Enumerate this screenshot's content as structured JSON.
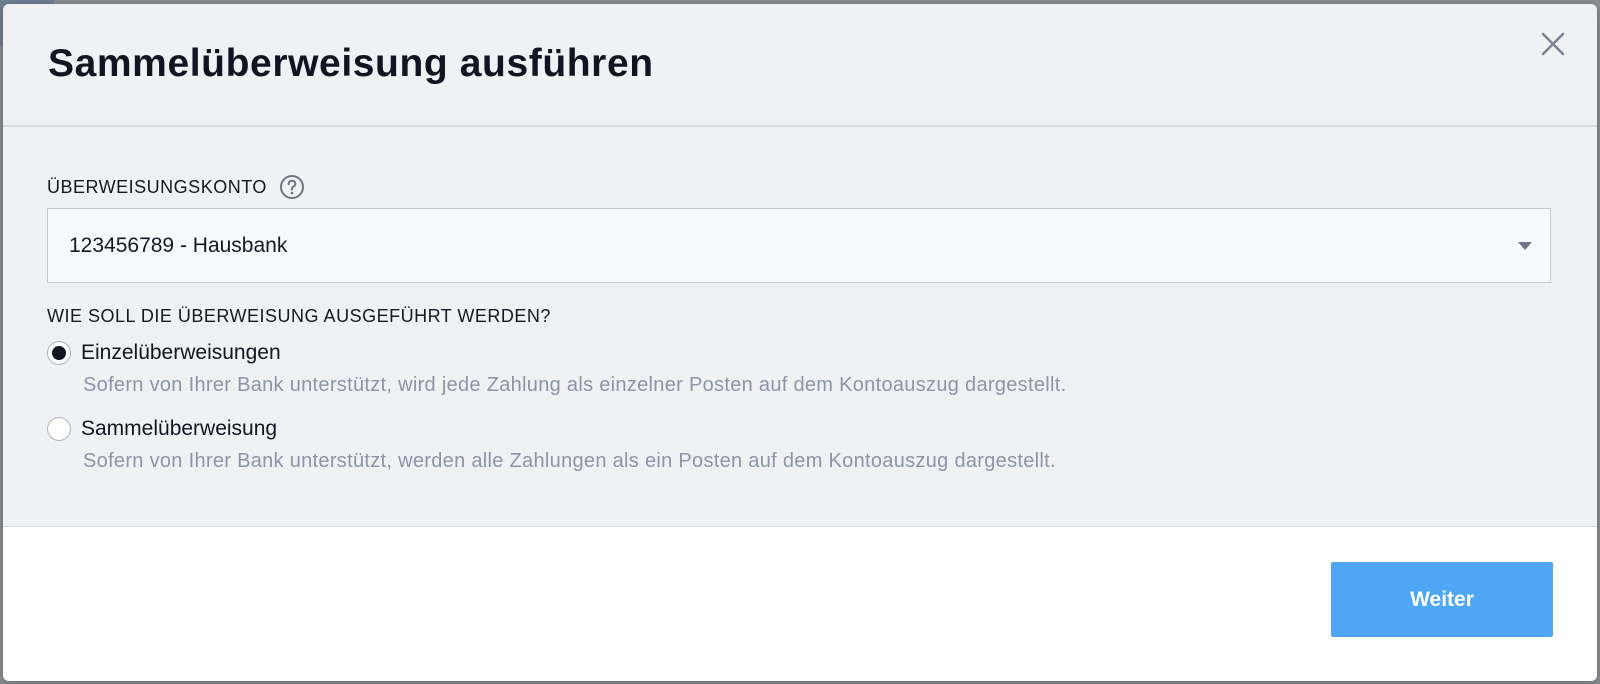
{
  "dialog": {
    "title": "Sammelüberweisung ausführen"
  },
  "account_field": {
    "label": "ÜBERWEISUNGSKONTO",
    "selected_value": "123456789 - Hausbank"
  },
  "execution": {
    "question": "WIE SOLL DIE ÜBERWEISUNG AUSGEFÜHRT WERDEN?",
    "options": [
      {
        "label": "Einzelüberweisungen",
        "description": "Sofern von Ihrer Bank unterstützt, wird jede Zahlung als einzelner Posten auf dem Kontoauszug dargestellt.",
        "selected": true
      },
      {
        "label": "Sammelüberweisung",
        "description": "Sofern von Ihrer Bank unterstützt, werden alle Zahlungen als ein Posten auf dem Kontoauszug dargestellt.",
        "selected": false
      }
    ]
  },
  "footer": {
    "next_label": "Weiter"
  },
  "icons": {
    "close": "close-icon",
    "help": "help-circle-icon",
    "dropdown": "chevron-down-icon"
  },
  "colors": {
    "primary_button": "#4ea6f5",
    "description_text": "#8c95a8",
    "title_text": "#111522"
  }
}
